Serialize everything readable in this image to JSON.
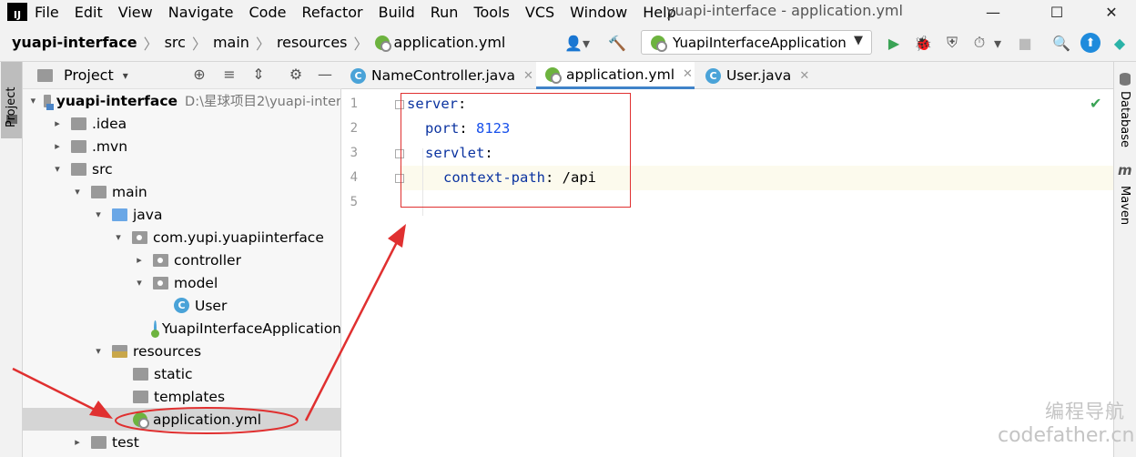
{
  "menubar": {
    "logo": "IJ",
    "items": [
      "File",
      "Edit",
      "View",
      "Navigate",
      "Code",
      "Refactor",
      "Build",
      "Run",
      "Tools",
      "VCS",
      "Window",
      "Help"
    ],
    "window_title": "yuapi-interface - application.yml",
    "controls": {
      "minimize": "—",
      "maximize": "☐",
      "close": "✕"
    }
  },
  "breadcrumbs": [
    "yuapi-interface",
    "src",
    "main",
    "resources",
    "application.yml"
  ],
  "run_config": {
    "label": "YuapiInterfaceApplication",
    "caret": "▼"
  },
  "toolbar_icons": [
    "user-icon",
    "hammer-icon",
    "run-icon",
    "debug-icon",
    "coverage-icon",
    "profile-icon",
    "stop-icon",
    "search-icon",
    "update-icon",
    "toolbox-icon"
  ],
  "toolbar_glyphs": {
    "user": "👤▾",
    "hammer": "🔨",
    "run": "▶",
    "debug": "🐞",
    "coverage": "⛨",
    "profile": "⏱",
    "more": "▾",
    "stop": "■",
    "search": "🔍",
    "update": "⬆",
    "toolbox": "◆"
  },
  "left_strip": {
    "project_tab": "Project"
  },
  "project_panel": {
    "title": "Project",
    "title_caret": "▾",
    "icons": {
      "locate": "⊕",
      "expand": "≡",
      "collapse": "⇕",
      "settings": "⚙",
      "hide": "—"
    },
    "tree": [
      {
        "label": "yuapi-interface",
        "hint": "D:\\星球项目2\\yuapi-inter",
        "depth": 0,
        "arrow": "▾",
        "icon": "module",
        "bold": true
      },
      {
        "label": ".idea",
        "depth": 1,
        "arrow": "▸",
        "icon": "folder"
      },
      {
        "label": ".mvn",
        "depth": 1,
        "arrow": "▸",
        "icon": "folder"
      },
      {
        "label": "src",
        "depth": 1,
        "arrow": "▾",
        "icon": "folder"
      },
      {
        "label": "main",
        "depth": 2,
        "arrow": "▾",
        "icon": "folder"
      },
      {
        "label": "java",
        "depth": 3,
        "arrow": "▾",
        "icon": "folder-blue"
      },
      {
        "label": "com.yupi.yuapiinterface",
        "depth": 4,
        "arrow": "▾",
        "icon": "package"
      },
      {
        "label": "controller",
        "depth": 5,
        "arrow": "▸",
        "icon": "package"
      },
      {
        "label": "model",
        "depth": 5,
        "arrow": "▾",
        "icon": "package"
      },
      {
        "label": "User",
        "depth": 6,
        "arrow": "",
        "icon": "class"
      },
      {
        "label": "YuapiInterfaceApplication",
        "depth": 5,
        "arrow": "",
        "icon": "app-class"
      },
      {
        "label": "resources",
        "depth": 3,
        "arrow": "▾",
        "icon": "resources"
      },
      {
        "label": "static",
        "depth": 4,
        "arrow": "",
        "icon": "folder"
      },
      {
        "label": "templates",
        "depth": 4,
        "arrow": "",
        "icon": "folder"
      },
      {
        "label": "application.yml",
        "depth": 4,
        "arrow": "",
        "icon": "yml",
        "selected": true
      },
      {
        "label": "test",
        "depth": 2,
        "arrow": "▸",
        "icon": "folder"
      }
    ]
  },
  "editor_tabs": [
    {
      "label": "NameController.java",
      "icon": "class",
      "active": false
    },
    {
      "label": "application.yml",
      "icon": "yml",
      "active": true
    },
    {
      "label": "User.java",
      "icon": "class",
      "active": false
    }
  ],
  "tab_close": "✕",
  "class_letter": "C",
  "editor": {
    "line_numbers": [
      "1",
      "2",
      "3",
      "4",
      "5"
    ],
    "lines": [
      {
        "key": "server",
        "sep": ":",
        "value": ""
      },
      {
        "key": "port",
        "sep": ": ",
        "value": "8123"
      },
      {
        "key": "servlet",
        "sep": ":",
        "value": ""
      },
      {
        "key": "context-path",
        "sep": ": ",
        "value": "/api"
      },
      {
        "key": "",
        "sep": "",
        "value": ""
      }
    ],
    "status_check": "✔"
  },
  "right_strip": {
    "database": "Database",
    "maven": "Maven",
    "maven_glyph": "m"
  },
  "watermark": {
    "line1": "编程导航",
    "line2": "codefather.cn"
  },
  "colors": {
    "accent": "#4083c9",
    "annotation": "#e03030",
    "keyword": "#0b33a0",
    "number": "#1750eb",
    "selection": "#d5d5d5"
  }
}
